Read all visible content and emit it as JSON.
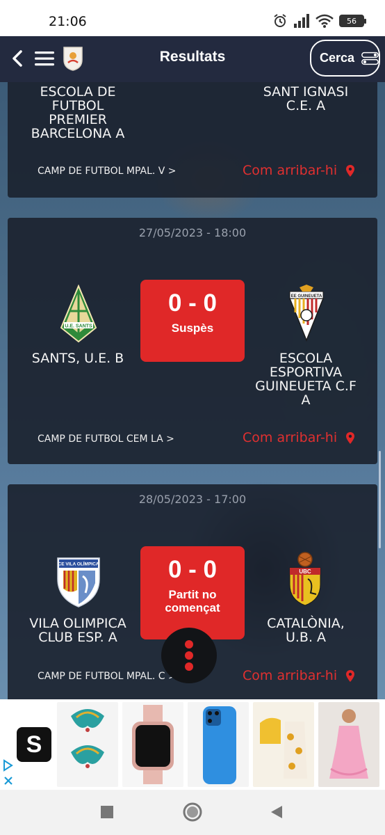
{
  "status": {
    "time": "21:06",
    "battery": "56"
  },
  "header": {
    "title": "Resultats",
    "search_label": "Cerca"
  },
  "matches": [
    {
      "date": "",
      "home": "ESCOLA DE FUTBOL PREMIER BARCELONA A",
      "away": "SANT IGNASI C.E. A",
      "venue": "CAMP DE FUTBOL MPAL. V >",
      "directions": "Com arribar-hi"
    },
    {
      "date": "27/05/2023 - 18:00",
      "home": "SANTS, U.E. B",
      "away": "ESCOLA ESPORTIVA GUINEUETA C.F A",
      "score": "0 - 0",
      "status": "Suspès",
      "venue": "CAMP DE FUTBOL CEM LA >",
      "directions": "Com arribar-hi",
      "home_crest_text": "U.E. SANTS",
      "away_crest_text": "EE GUINEUETA"
    },
    {
      "date": "28/05/2023 - 17:00",
      "home": "VILA OLIMPICA CLUB ESP. A",
      "away": "CATALÒNIA, U.B. A",
      "score": "0 - 0",
      "status": "Partit no començat",
      "venue": "CAMP DE FUTBOL MPAL. C >",
      "directions": "Com arribar-hi",
      "home_crest_text": "CE VILA OLÍMPICA",
      "away_crest_text": "UBC"
    }
  ],
  "colors": {
    "accent": "#e02828",
    "header_bg": "#232a3f",
    "card_bg": "#1b212e"
  },
  "ad": {
    "logo_letter": "S"
  }
}
